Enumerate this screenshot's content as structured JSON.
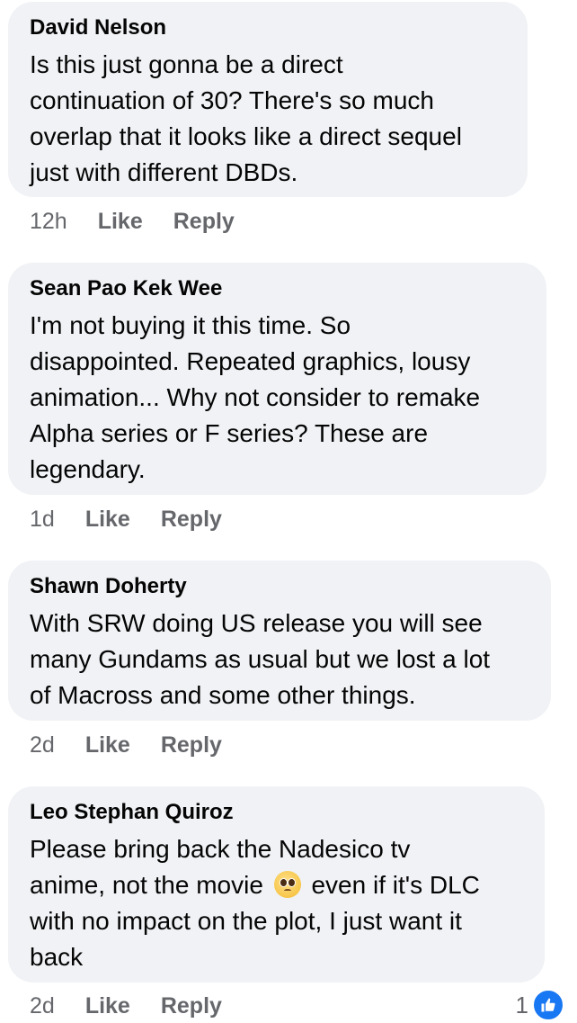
{
  "comments": [
    {
      "author": "David Nelson",
      "lines": [
        "Is this just gonna be a direct",
        "continuation of 30? There's so much",
        "overlap that it looks like a direct sequel",
        "just with different DBDs."
      ],
      "time": "12h",
      "like_label": "Like",
      "reply_label": "Reply"
    },
    {
      "author": "Sean Pao Kek Wee",
      "lines": [
        "I'm not buying it this time. So",
        "disappointed. Repeated graphics, lousy",
        "animation... Why not consider to remake",
        "Alpha series or F series? These are",
        "legendary."
      ],
      "time": "1d",
      "like_label": "Like",
      "reply_label": "Reply"
    },
    {
      "author": "Shawn Doherty",
      "lines": [
        "With SRW doing US release you will see",
        "many Gundams as usual but we lost a lot",
        "of Macross and some other things."
      ],
      "time": "2d",
      "like_label": "Like",
      "reply_label": "Reply"
    },
    {
      "author": "Leo Stephan Quiroz",
      "lines": [
        "Please bring back the Nadesico tv",
        "anime, not the movie",
        "even if it's DLC",
        "with no impact on the plot, I just want it",
        "back"
      ],
      "emoji": "pleading-face-emoji",
      "time": "2d",
      "like_label": "Like",
      "reply_label": "Reply",
      "reaction_count": "1",
      "reaction_icon": "like-reaction-icon"
    }
  ],
  "colors": {
    "bubble": "#f0f2f5",
    "text": "#050505",
    "meta": "#65676b",
    "like_blue": "#1877f2"
  }
}
